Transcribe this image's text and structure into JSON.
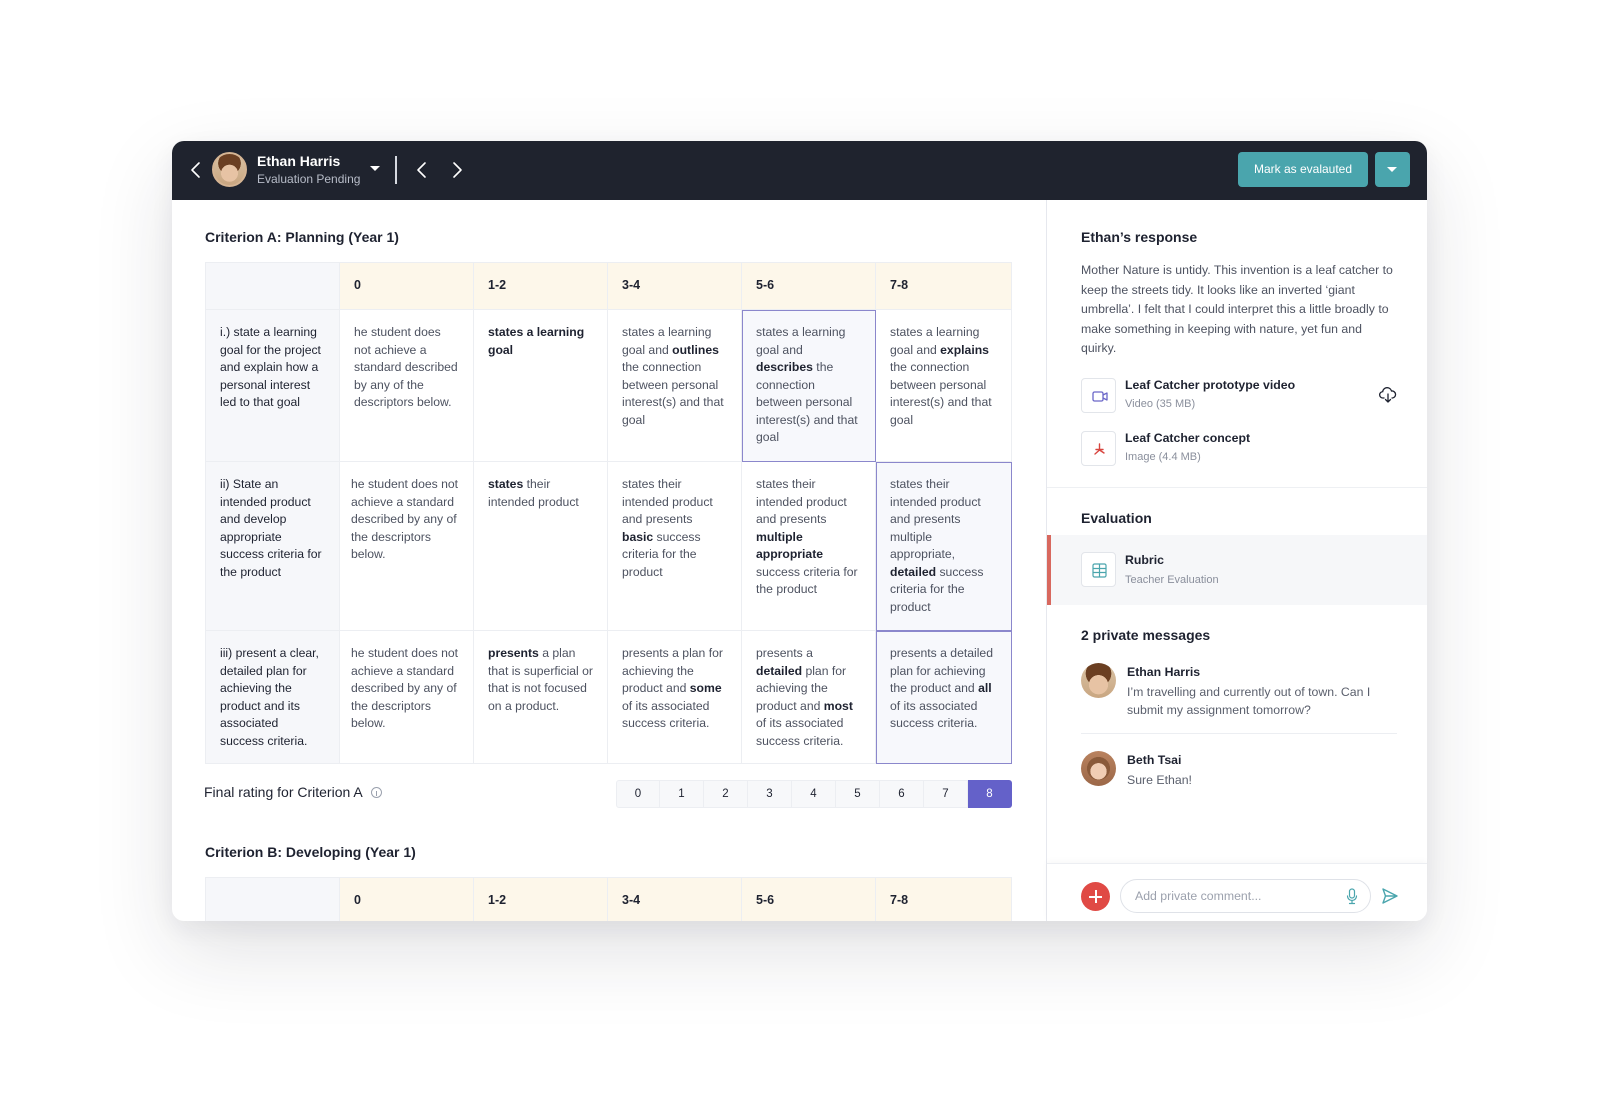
{
  "topbar": {
    "student_name": "Ethan Harris",
    "status": "Evaluation Pending",
    "mark_button": "Mark as evalauted"
  },
  "criteria": [
    {
      "title": "Criterion A: Planning (Year 1)",
      "levels": [
        "0",
        "1-2",
        "3-4",
        "5-6",
        "7-8"
      ],
      "rows": [
        {
          "criterion": "i.) state a learning goal for the project and explain how a personal interest led to that goal",
          "cells": [
            "he student does not achieve a standard described by any of the descriptors below.",
            "<b>states a learning goal</b>",
            "states a learning goal and <b>outlines</b> the connection between personal interest(s) and that goal",
            "states a learning goal and <b>describes</b> the connection between personal interest(s) and that goal",
            "states a learning goal and <b>explains</b> the connection between personal interest(s) and that goal"
          ],
          "selected_level": "5-6"
        },
        {
          "criterion": "ii) State an intended product and develop appropriate success criteria for the product",
          "cells": [
            "he student does not achieve a standard described by any of the descriptors below.",
            "<b>states</b> their intended product",
            "states their intended product and presents <b>basic</b> success criteria for the product",
            "states their intended product and presents <b>multiple appropriate</b> success criteria for the product",
            "states their intended product and presents multiple appropriate, <b>detailed</b> success criteria for the product"
          ],
          "selected_level": "7-8"
        },
        {
          "criterion": "iii) present a clear, detailed plan for achieving the product and its associated success criteria.",
          "cells": [
            "he student does not achieve a standard described by any of the descriptors below.",
            "<b>presents</b> a plan that is superficial or that is not focused on a product.",
            "presents a plan for achieving the product and <b>some</b> of its associated success criteria.",
            "presents a <b>detailed</b> plan for achieving the product and <b>most</b> of its associated success criteria.",
            "presents a detailed plan for achieving the product and <b>all</b> of its associated success criteria."
          ],
          "selected_level": "7-8"
        }
      ],
      "final_rating": {
        "label": "Final rating for Criterion A",
        "options": [
          "0",
          "1",
          "2",
          "3",
          "4",
          "5",
          "6",
          "7",
          "8"
        ],
        "selected": "8"
      }
    },
    {
      "title": "Criterion B: Developing (Year 1)",
      "levels": [
        "0",
        "1-2",
        "3-4",
        "5-6",
        "7-8"
      ]
    }
  ],
  "sidebar": {
    "response_title": "Ethan’s response",
    "response_text": "Mother Nature is untidy. This invention is a leaf catcher to keep the streets tidy. It looks like an inverted ‘giant umbrella’. I felt that I could interpret this a little broadly to make something in keeping with nature, yet fun and quirky.",
    "attachments": [
      {
        "name": "Leaf Catcher prototype video",
        "meta": "Video (35 MB)",
        "icon": "video-icon"
      },
      {
        "name": "Leaf Catcher concept",
        "meta": "Image (4.4 MB)",
        "icon": "pdf-icon"
      }
    ],
    "evaluation_title": "Evaluation",
    "evaluation_item": {
      "name": "Rubric",
      "meta": "Teacher Evaluation"
    },
    "messages_title": "2 private messages",
    "messages": [
      {
        "author": "Ethan Harris",
        "text": "I’m travelling and currently out of town. Can I submit my assignment tomorrow?"
      },
      {
        "author": "Beth Tsai",
        "text": "Sure Ethan!"
      }
    ],
    "comment_placeholder": "Add private comment..."
  },
  "colors": {
    "topbar_bg": "#1f232e",
    "accent_teal": "#4aa5ad",
    "rating_active": "#6461c9",
    "selected_outline": "#8b87cc",
    "header_cell_bg": "#fdf7ea",
    "add_button": "#e04a45"
  }
}
